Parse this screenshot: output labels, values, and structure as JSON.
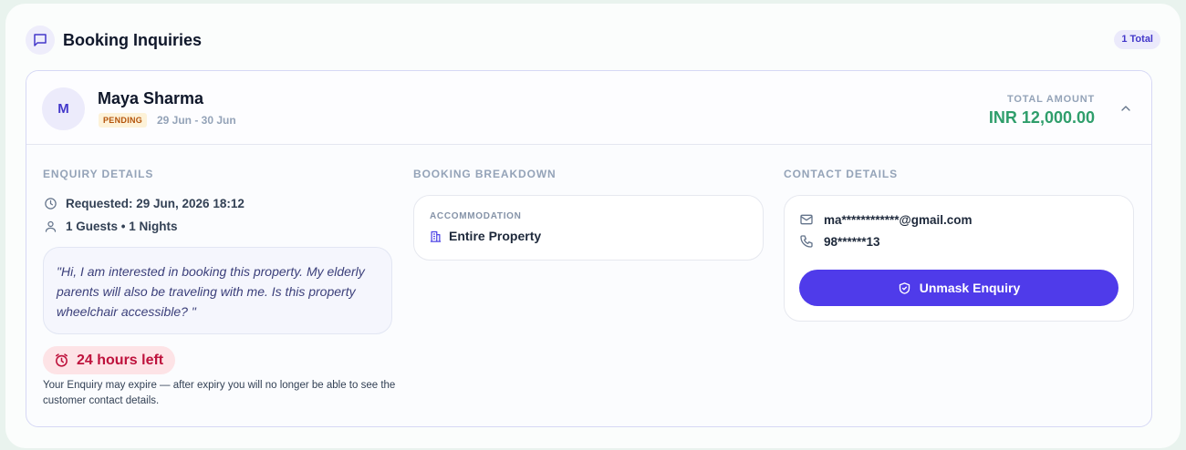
{
  "header": {
    "title": "Booking Inquiries",
    "total_badge": "1 Total",
    "icon": "chat-bubble-icon"
  },
  "inquiry": {
    "avatar_initial": "M",
    "guest_name": "Maya Sharma",
    "status": "PENDING",
    "date_range": "29 Jun - 30 Jun",
    "total_label": "TOTAL AMOUNT",
    "total_amount": "INR 12,000.00",
    "enquiry_details": {
      "heading": "ENQUIRY DETAILS",
      "requested": "Requested: 29 Jun, 2026 18:12",
      "guests_nights": "1 Guests • 1 Nights",
      "message": "\"Hi, I am interested in booking this property. My elderly parents will also be traveling with me. Is this property wheelchair accessible? \"",
      "time_left": "24 hours left",
      "expiry_note": "Your Enquiry may expire — after expiry you will no longer be able to see the customer contact details."
    },
    "booking_breakdown": {
      "heading": "BOOKING BREAKDOWN",
      "accommodation_label": "ACCOMMODATION",
      "accommodation_value": "Entire Property"
    },
    "contact_details": {
      "heading": "CONTACT DETAILS",
      "email": "ma************@gmail.com",
      "phone": "98******13",
      "unmask_label": "Unmask Enquiry"
    }
  },
  "colors": {
    "accent": "#4f3bea",
    "amount_green": "#2f9e6b",
    "pending_text": "#b45309",
    "pending_bg": "#fdf2d8",
    "timer_text": "#be123c",
    "timer_bg": "#fde3e6"
  }
}
